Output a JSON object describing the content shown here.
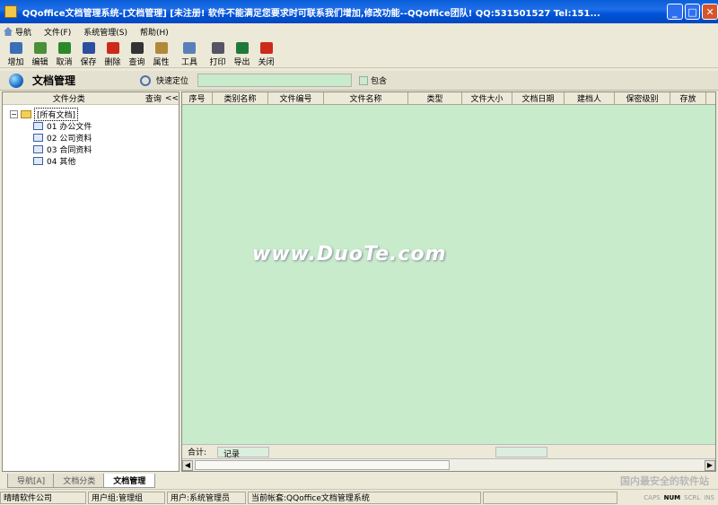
{
  "window": {
    "title": "QQoffice文档管理系统-[文档管理]  [未注册! 软件不能满足您要求时可联系我们增加,修改功能--QQoffice团队! QQ:531501527 Tel:151...",
    "btn_min": "_",
    "btn_max": "□",
    "btn_close": "✕"
  },
  "menu": [
    {
      "label": "导航"
    },
    {
      "label": "文件(F)"
    },
    {
      "label": "系统管理(S)"
    },
    {
      "label": "帮助(H)"
    }
  ],
  "toolbar": [
    {
      "label": "增加",
      "icon": "new-file-icon",
      "color": "#3a6fb8"
    },
    {
      "label": "编辑",
      "icon": "edit-icon",
      "color": "#4a8f3a"
    },
    {
      "label": "取消",
      "icon": "undo-icon",
      "color": "#2a8a2a"
    },
    {
      "label": "保存",
      "icon": "save-icon",
      "color": "#2b4fa0"
    },
    {
      "label": "删除",
      "icon": "delete-icon",
      "color": "#cc2a1a"
    },
    {
      "label": "查询",
      "icon": "binoculars-icon",
      "color": "#333333"
    },
    {
      "label": "属性",
      "icon": "properties-icon",
      "color": "#b08a3a"
    },
    {
      "label": "工具",
      "icon": "tools-icon",
      "color": "#5b7fb8"
    },
    {
      "label": "打印",
      "icon": "printer-icon",
      "color": "#555566"
    },
    {
      "label": "导出",
      "icon": "excel-export-icon",
      "color": "#1f7a3a"
    },
    {
      "label": "关闭",
      "icon": "close-icon",
      "color": "#cc2a1a"
    }
  ],
  "header": {
    "title": "文档管理",
    "quick_locate": "快速定位",
    "contains": "包含"
  },
  "tree": {
    "col_label": "文件分类",
    "query_label": "查询",
    "collapse": "<<",
    "root": "[所有文档]",
    "expander": "−",
    "items": [
      {
        "label": "01 办公文件"
      },
      {
        "label": "02 公司资料"
      },
      {
        "label": "03 合同资料"
      },
      {
        "label": "04 其他"
      }
    ]
  },
  "grid": {
    "columns": [
      "序号",
      "类别名称",
      "文件编号",
      "文件名称",
      "类型",
      "文件大小",
      "文档日期",
      "建档人",
      "保密级别",
      "存放"
    ],
    "watermark": "www.DuoTe.com",
    "footer_sum": "合计:",
    "footer_records": "记录",
    "scroll_left": "◀",
    "scroll_right": "▶"
  },
  "tabs": [
    {
      "label": "导航[A]"
    },
    {
      "label": "文档分类"
    },
    {
      "label": "文档管理"
    }
  ],
  "brand": "国内最安全的软件站",
  "status": {
    "company": "晴晴软件公司",
    "group": "用户组:管理组",
    "user": "用户:系统管理员",
    "account": "当前帐套:QQoffice文档管理系统",
    "keys": [
      "CAPS",
      "NUM",
      "SCRL",
      "INS"
    ]
  }
}
